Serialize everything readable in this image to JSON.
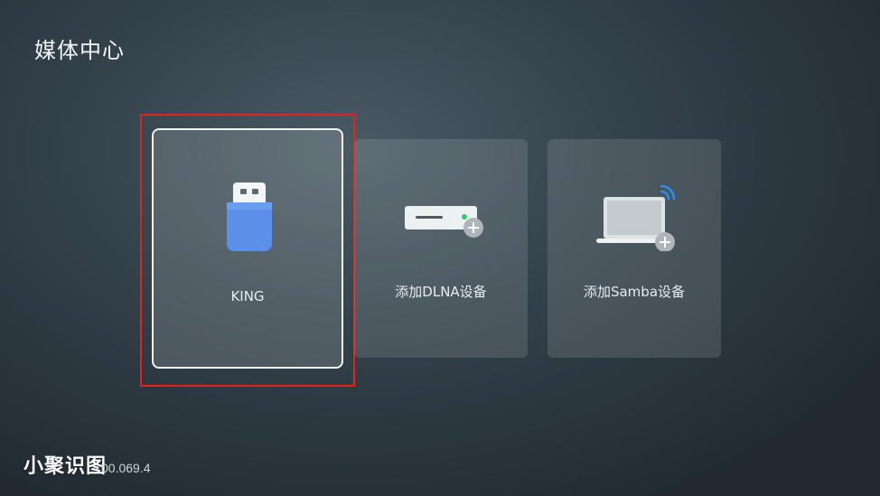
{
  "header": {
    "title": "媒体中心"
  },
  "devices": [
    {
      "label": "KING",
      "icon": "usb-drive-icon",
      "focused": true
    },
    {
      "label": "添加DLNA设备",
      "icon": "dlna-server-add-icon",
      "focused": false
    },
    {
      "label": "添加Samba设备",
      "icon": "samba-laptop-add-icon",
      "focused": false
    }
  ],
  "colors": {
    "focus_ring": "#e0231d",
    "usb_blue": "#5b8fe8",
    "status_led": "#2ecc71"
  },
  "footer": {
    "watermark": "小聚识图",
    "version": "00.069.4"
  }
}
